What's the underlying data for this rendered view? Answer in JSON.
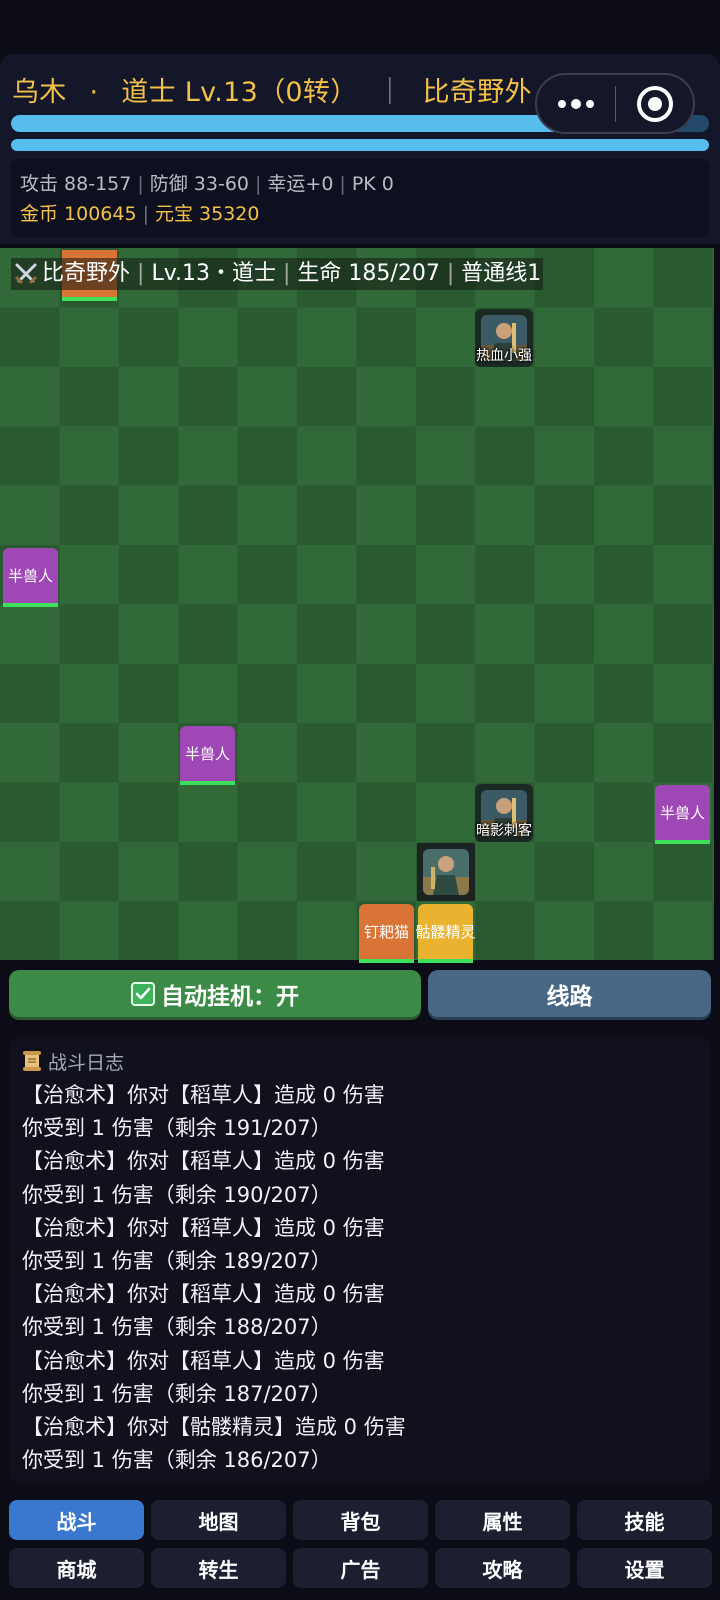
{
  "header": {
    "name": "乌木",
    "dot": "·",
    "class_level": "道士 Lv.13（0转）",
    "sep": "｜",
    "map": "比奇野外",
    "hp_fraction": 0.9,
    "mp_fraction": 1.0
  },
  "capsule": {
    "more_icon": "more-dots-icon",
    "close_icon": "target-icon"
  },
  "stats": {
    "attack": "攻击 88-157",
    "defense": "防御 33-60",
    "luck": "幸运+0",
    "pk": "PK 0",
    "gold": "金币 100645",
    "yuanbao": "元宝 35320",
    "divider": "|"
  },
  "field": {
    "banner": {
      "map": "比奇野外",
      "level": "Lv.13・道士",
      "life": "生命 185/207",
      "line": "普通线1",
      "divider": "|"
    },
    "mobs": [
      {
        "name": "",
        "color": "orange"
      },
      {
        "name": "半兽人",
        "color": "purple"
      },
      {
        "name": "半兽人",
        "color": "purple"
      },
      {
        "name": "半兽人",
        "color": "purple"
      },
      {
        "name": "钉耙猫",
        "color": "orange"
      },
      {
        "name": "骷髅精灵",
        "color": "yellow"
      }
    ],
    "players": [
      {
        "name": "热血小强"
      },
      {
        "name": "暗影刺客"
      }
    ]
  },
  "actions": {
    "auto": "自动挂机：开",
    "line": "线路"
  },
  "log": {
    "title": "战斗日志",
    "lines": [
      "【治愈术】你对【稻草人】造成 0 伤害",
      "你受到 1 伤害（剩余 191/207）",
      "【治愈术】你对【稻草人】造成 0 伤害",
      "你受到 1 伤害（剩余 190/207）",
      "【治愈术】你对【稻草人】造成 0 伤害",
      "你受到 1 伤害（剩余 189/207）",
      "【治愈术】你对【稻草人】造成 0 伤害",
      "你受到 1 伤害（剩余 188/207）",
      "【治愈术】你对【稻草人】造成 0 伤害",
      "你受到 1 伤害（剩余 187/207）",
      "【治愈术】你对【骷髅精灵】造成 0 伤害",
      "你受到 1 伤害（剩余 186/207）"
    ]
  },
  "nav": {
    "row1": [
      "战斗",
      "地图",
      "背包",
      "属性",
      "技能"
    ],
    "row2": [
      "商城",
      "转生",
      "广告",
      "攻略",
      "设置"
    ],
    "active": "战斗"
  },
  "colors": {
    "accent_gold": "#f3c048",
    "bar_blue": "#56bdec",
    "active_tab": "#3a78d0",
    "auto_green": "#3b8a45"
  }
}
